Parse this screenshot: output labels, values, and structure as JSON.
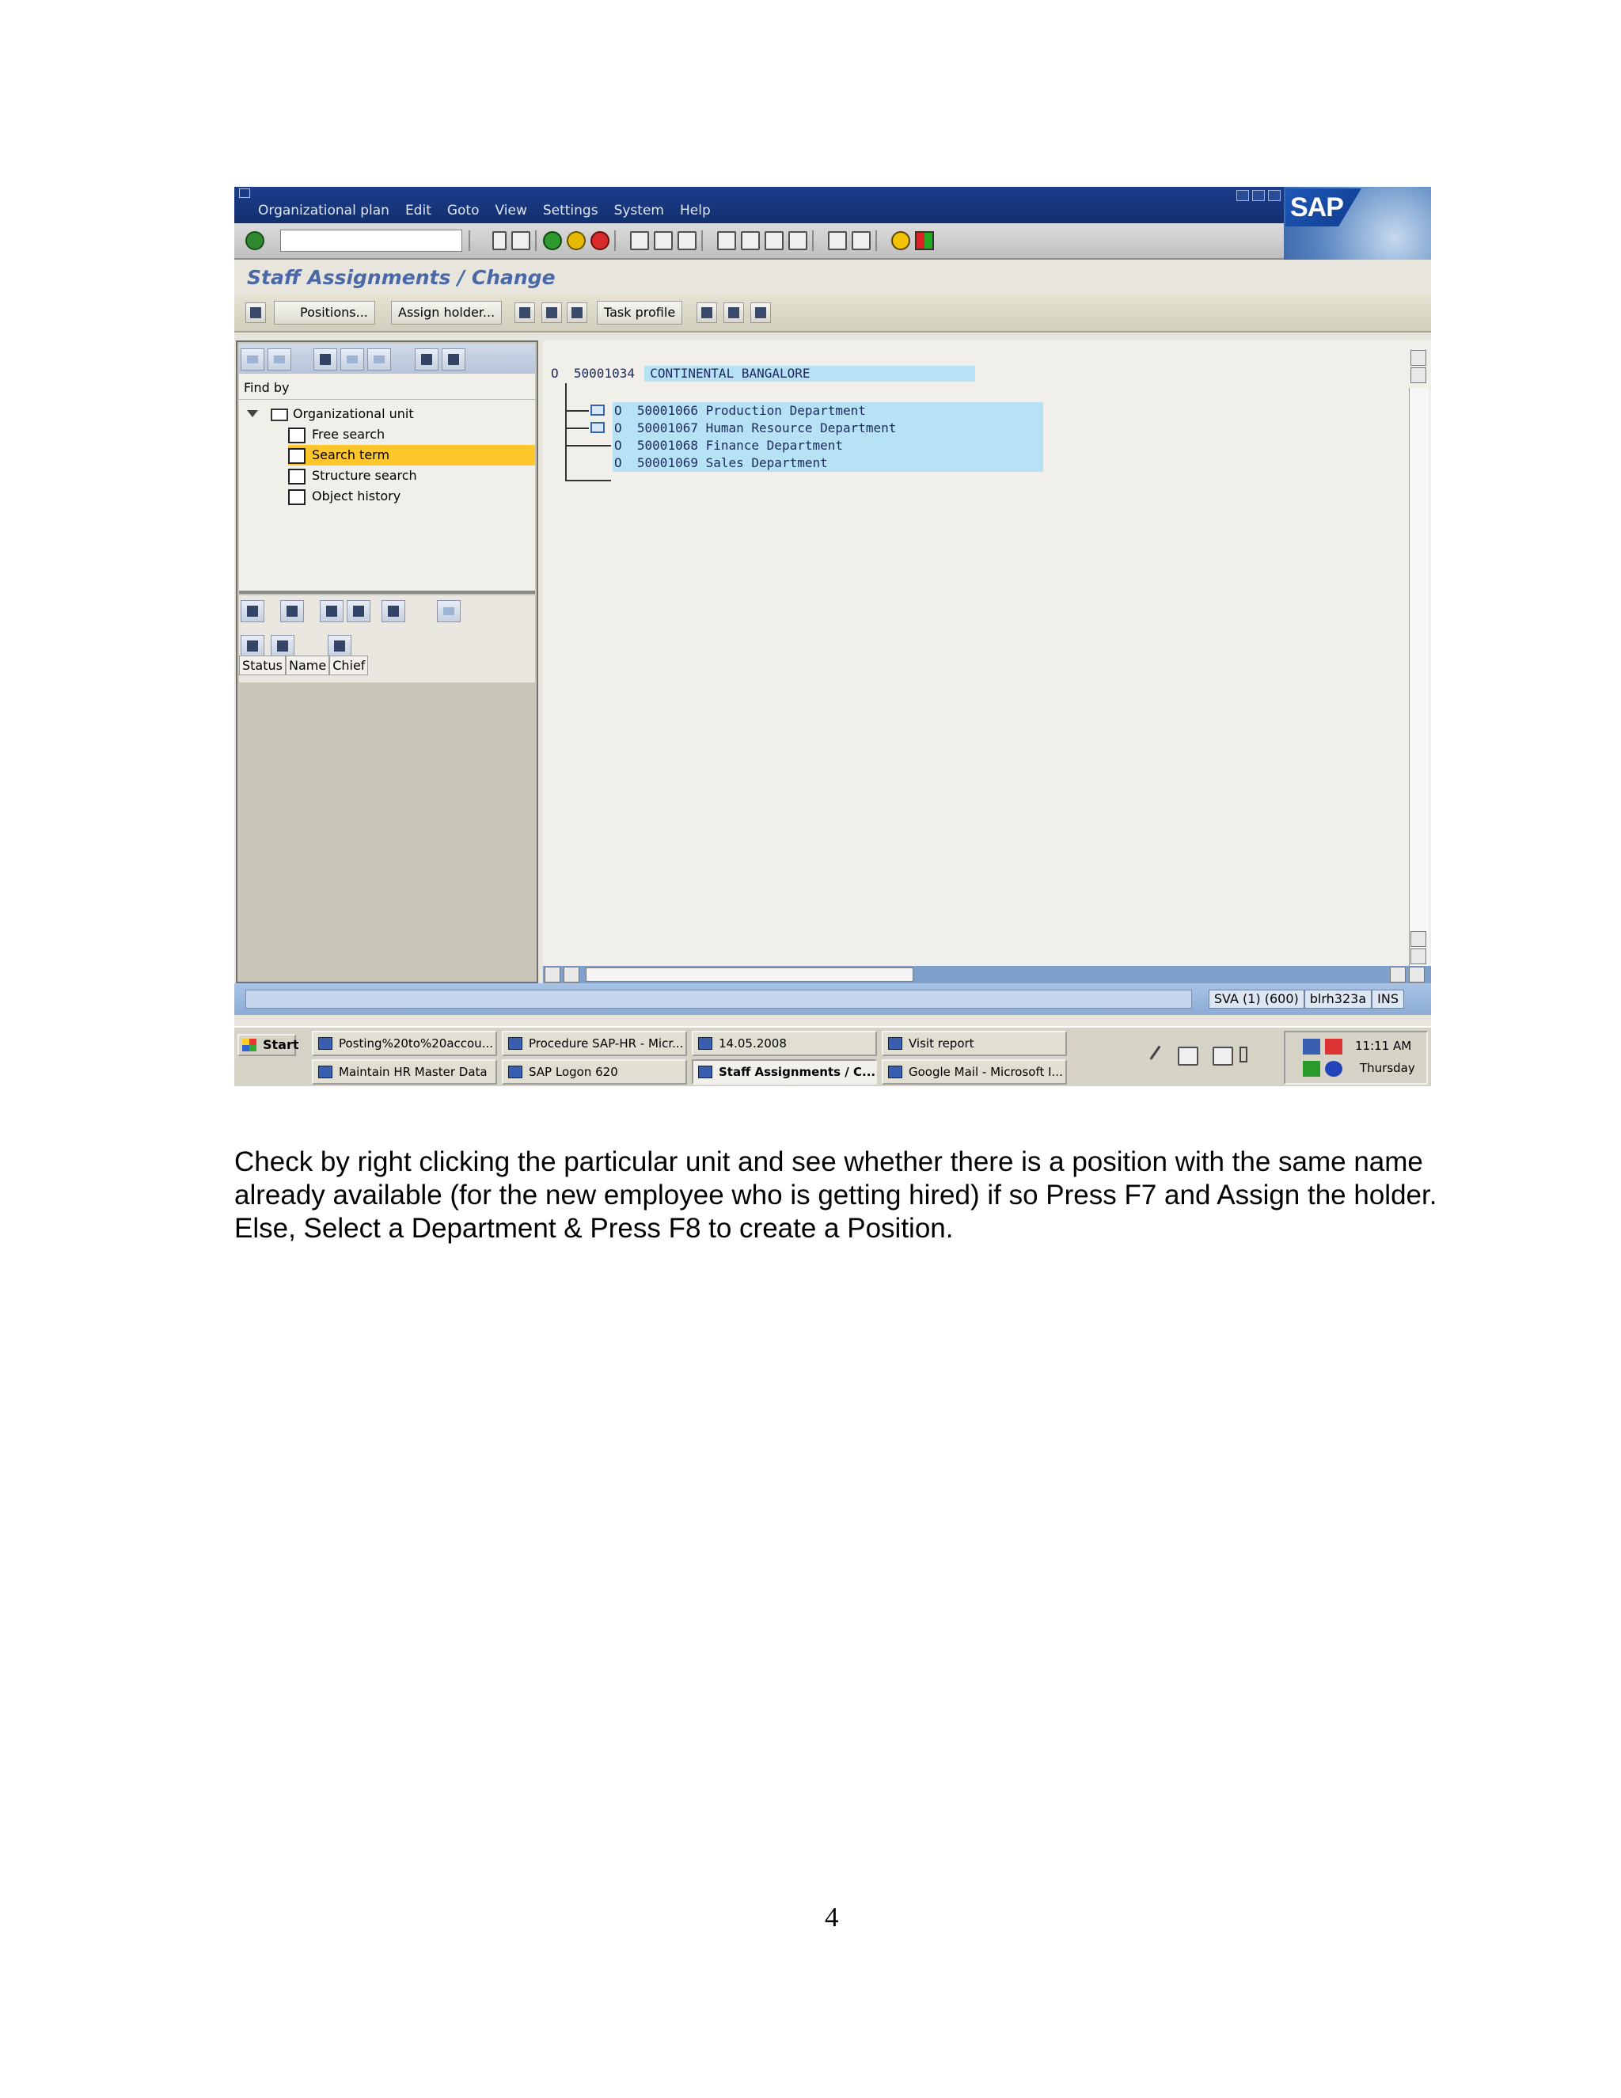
{
  "menu": {
    "items": [
      "Organizational plan",
      "Edit",
      "Goto",
      "View",
      "Settings",
      "System",
      "Help"
    ]
  },
  "brand": {
    "logo": "SAP"
  },
  "screen": {
    "title": "Staff Assignments / Change"
  },
  "app_toolbar": {
    "positions_label": "Positions...",
    "assign_holder_label": "Assign holder...",
    "task_profile_label": "Task profile"
  },
  "nav": {
    "find_by_label": "Find by",
    "org_unit_label": "Organizational unit",
    "search_items": [
      {
        "label": "Free search",
        "selected": false
      },
      {
        "label": "Search term",
        "selected": true
      },
      {
        "label": "Structure search",
        "selected": false
      },
      {
        "label": "Object history",
        "selected": false
      }
    ],
    "list_columns": [
      "Status",
      "Name",
      "Chief"
    ]
  },
  "structure": {
    "root": {
      "type": "O",
      "id": "50001034",
      "name": "CONTINENTAL BANGALORE"
    },
    "departments": [
      {
        "type": "O",
        "id": "50001066",
        "name": "Production Department",
        "expandable": true
      },
      {
        "type": "O",
        "id": "50001067",
        "name": "Human Resource Department",
        "expandable": true
      },
      {
        "type": "O",
        "id": "50001068",
        "name": "Finance Department",
        "expandable": false
      },
      {
        "type": "O",
        "id": "50001069",
        "name": "Sales Department",
        "expandable": false
      }
    ]
  },
  "status_bar": {
    "system": "SVA (1) (600)",
    "server": "blrh323a",
    "mode": "INS"
  },
  "taskbar": {
    "start_label": "Start",
    "tasks_top": [
      "Posting%20to%20accou...",
      "Procedure SAP-HR - Micr...",
      "14.05.2008",
      "Visit report"
    ],
    "tasks_bottom": [
      "Maintain HR Master Data",
      "SAP Logon 620",
      "Staff Assignments / C...",
      "Google Mail - Microsoft I..."
    ],
    "time": "11:11 AM",
    "day": "Thursday"
  },
  "document": {
    "instruction_text": "Check by right clicking the particular unit and see whether there is a position with the same name already available (for the new employee who is getting hired) if so Press F7 and Assign the holder. Else, Select a Department  &  Press F8   to create a Position.",
    "page_number": "4"
  }
}
